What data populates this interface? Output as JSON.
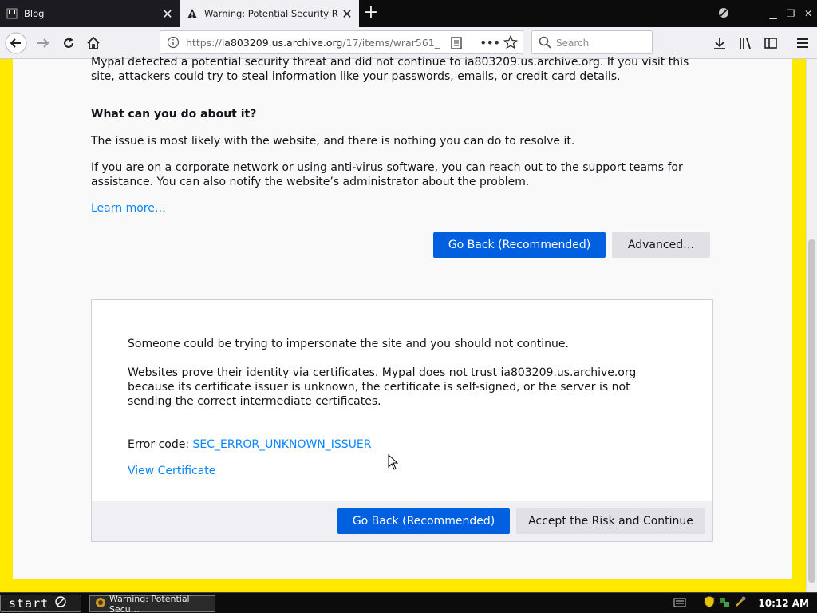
{
  "browser": {
    "tabs": [
      {
        "title": "Blog",
        "active": false
      },
      {
        "title": "Warning: Potential Security Risk Ah",
        "active": true
      }
    ],
    "url": {
      "prefix": "https://",
      "host": "ia803209.us.archive.org",
      "path": "/17/items/wrar561_"
    },
    "search_placeholder": "Search",
    "icons": [
      "back-icon",
      "forward-icon",
      "reload-icon",
      "home-icon",
      "info-icon",
      "reader-icon",
      "more-icon",
      "bookmark-star-icon",
      "search-icon",
      "download-icon",
      "library-icon",
      "sidebar-icon",
      "menu-icon"
    ]
  },
  "page": {
    "intro": "Mypal detected a potential security threat and did not continue to ia803209.us.archive.org. If you visit this site, attackers could try to steal information like your passwords, emails, or credit card details.",
    "heading": "What can you do about it?",
    "p1": "The issue is most likely with the website, and there is nothing you can do to resolve it.",
    "p2": "If you are on a corporate network or using anti-virus software, you can reach out to the support teams for assistance. You can also notify the website’s administrator about the problem.",
    "learn_more": "Learn more…",
    "go_back": "Go Back (Recommended)",
    "advanced": "Advanced…"
  },
  "advanced_panel": {
    "line1": "Someone could be trying to impersonate the site and you should not continue.",
    "line2": "Websites prove their identity via certificates. Mypal does not trust ia803209.us.archive.org because its certificate issuer is unknown, the certificate is self-signed, or the server is not sending the correct intermediate certificates.",
    "error_label": "Error code:",
    "error_code": "SEC_ERROR_UNKNOWN_ISSUER",
    "view_cert": "View Certificate",
    "go_back": "Go Back (Recommended)",
    "accept": "Accept the Risk and Continue"
  },
  "taskbar": {
    "start": "start",
    "task": "Warning: Potential Secu…",
    "clock": "10:12 AM"
  },
  "colors": {
    "frame": "#ffe900",
    "primary": "#0060df",
    "link": "#0a84ff"
  }
}
